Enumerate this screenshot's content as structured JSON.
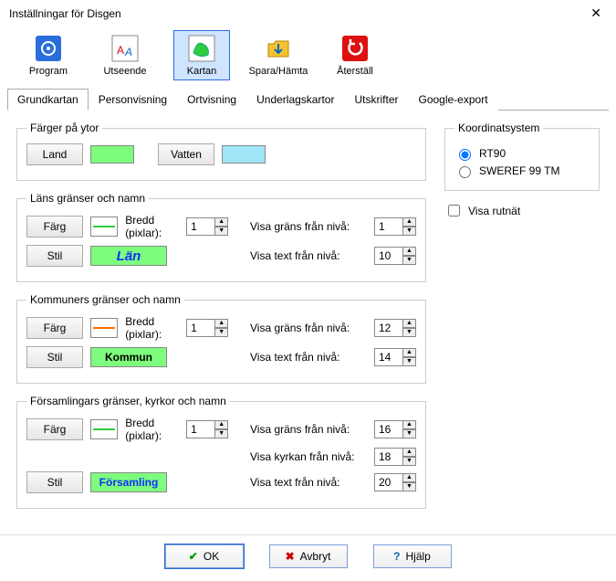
{
  "window": {
    "title": "Inställningar för Disgen"
  },
  "toolbar": [
    {
      "label": "Program"
    },
    {
      "label": "Utseende"
    },
    {
      "label": "Kartan"
    },
    {
      "label": "Spara/Hämta"
    },
    {
      "label": "Återställ"
    }
  ],
  "tabs": [
    "Grundkartan",
    "Personvisning",
    "Ortvisning",
    "Underlagskartor",
    "Utskrifter",
    "Google-export"
  ],
  "colors": {
    "land_swatch": "#7dfc7d",
    "water_swatch": "#a0e5f7",
    "lan_line": "#2ecc40",
    "kommun_line": "#ff6a00",
    "forsamling_line": "#2ecc40",
    "lan_bg": "#7dfc7d",
    "kommun_bg": "#7dfc7d",
    "forsamling_bg": "#7dfc7d",
    "lan_text": "#1030ff",
    "kommun_text": "#000000",
    "forsamling_text": "#1030ff"
  },
  "groups": {
    "surfaces": {
      "legend": "Färger på ytor",
      "land_btn": "Land",
      "water_btn": "Vatten"
    },
    "lan": {
      "legend": "Läns gränser och namn",
      "farg_btn": "Färg",
      "stil_btn": "Stil",
      "bredd_label": "Bredd (pixlar):",
      "bredd_val": "1",
      "grans_label": "Visa gräns från nivå:",
      "grans_val": "1",
      "text_label": "Visa text från nivå:",
      "text_val": "10",
      "sample_text": "Län"
    },
    "kommun": {
      "legend": "Kommuners gränser och namn",
      "farg_btn": "Färg",
      "stil_btn": "Stil",
      "bredd_label": "Bredd (pixlar):",
      "bredd_val": "1",
      "grans_label": "Visa gräns från nivå:",
      "grans_val": "12",
      "text_label": "Visa text från nivå:",
      "text_val": "14",
      "sample_text": "Kommun"
    },
    "forsamling": {
      "legend": "Församlingars gränser, kyrkor och namn",
      "farg_btn": "Färg",
      "stil_btn": "Stil",
      "bredd_label": "Bredd (pixlar):",
      "bredd_val": "1",
      "grans_label": "Visa gräns från nivå:",
      "grans_val": "16",
      "kyrka_label": "Visa kyrkan från nivå:",
      "kyrka_val": "18",
      "text_label": "Visa text från nivå:",
      "text_val": "20",
      "sample_text": "Församling"
    }
  },
  "coord": {
    "legend": "Koordinatsystem",
    "opt1": "RT90",
    "opt2": "SWEREF 99 TM"
  },
  "grid_chk": "Visa rutnät",
  "dlg": {
    "ok": "OK",
    "cancel": "Avbryt",
    "help": "Hjälp"
  }
}
